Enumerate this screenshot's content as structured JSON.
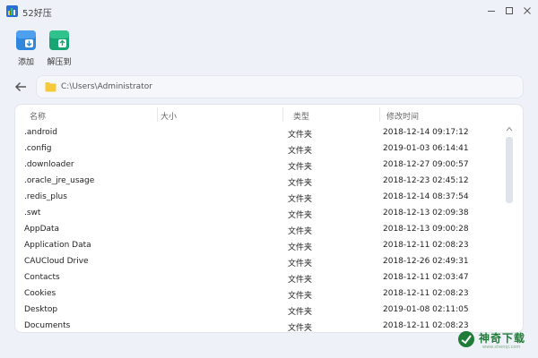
{
  "window": {
    "title": "52好压"
  },
  "toolbar": {
    "add_label": "添加",
    "extract_label": "解压到"
  },
  "path": {
    "value": "C:\\Users\\Administrator"
  },
  "table": {
    "columns": [
      "名称",
      "大小",
      "类型",
      "修改时间"
    ],
    "rows": [
      {
        "name": ".android",
        "size": "",
        "type": "文件夹",
        "modified": "2018-12-14 09:17:12"
      },
      {
        "name": ".config",
        "size": "",
        "type": "文件夹",
        "modified": "2019-01-03 06:14:41"
      },
      {
        "name": ".downloader",
        "size": "",
        "type": "文件夹",
        "modified": "2018-12-27 09:00:57"
      },
      {
        "name": ".oracle_jre_usage",
        "size": "",
        "type": "文件夹",
        "modified": "2018-12-23 02:45:12"
      },
      {
        "name": ".redis_plus",
        "size": "",
        "type": "文件夹",
        "modified": "2018-12-14 08:37:54"
      },
      {
        "name": ".swt",
        "size": "",
        "type": "文件夹",
        "modified": "2018-12-13 02:09:38"
      },
      {
        "name": "AppData",
        "size": "",
        "type": "文件夹",
        "modified": "2018-12-13 09:00:28"
      },
      {
        "name": "Application Data",
        "size": "",
        "type": "文件夹",
        "modified": "2018-12-11 02:08:23"
      },
      {
        "name": "CAUCloud Drive",
        "size": "",
        "type": "文件夹",
        "modified": "2018-12-26 02:49:31"
      },
      {
        "name": "Contacts",
        "size": "",
        "type": "文件夹",
        "modified": "2018-12-11 02:03:47"
      },
      {
        "name": "Cookies",
        "size": "",
        "type": "文件夹",
        "modified": "2018-12-11 02:08:23"
      },
      {
        "name": "Desktop",
        "size": "",
        "type": "文件夹",
        "modified": "2019-01-08 02:11:05"
      },
      {
        "name": "Documents",
        "size": "",
        "type": "文件夹",
        "modified": "2018-12-11 02:08:23"
      }
    ]
  },
  "watermark": {
    "text": "神奇下载",
    "sub": "www.shenqi.com"
  },
  "colors": {
    "background": "#eef1f7",
    "add_icon": "#2f86dd",
    "extract_icon": "#17a673",
    "folder": "#f6c93a",
    "watermark": "#1f7c37"
  },
  "icons": {
    "app": "app-logo-icon",
    "add": "add-archive-icon",
    "extract": "extract-archive-icon",
    "back": "arrow-left-icon",
    "folder": "folder-icon"
  }
}
